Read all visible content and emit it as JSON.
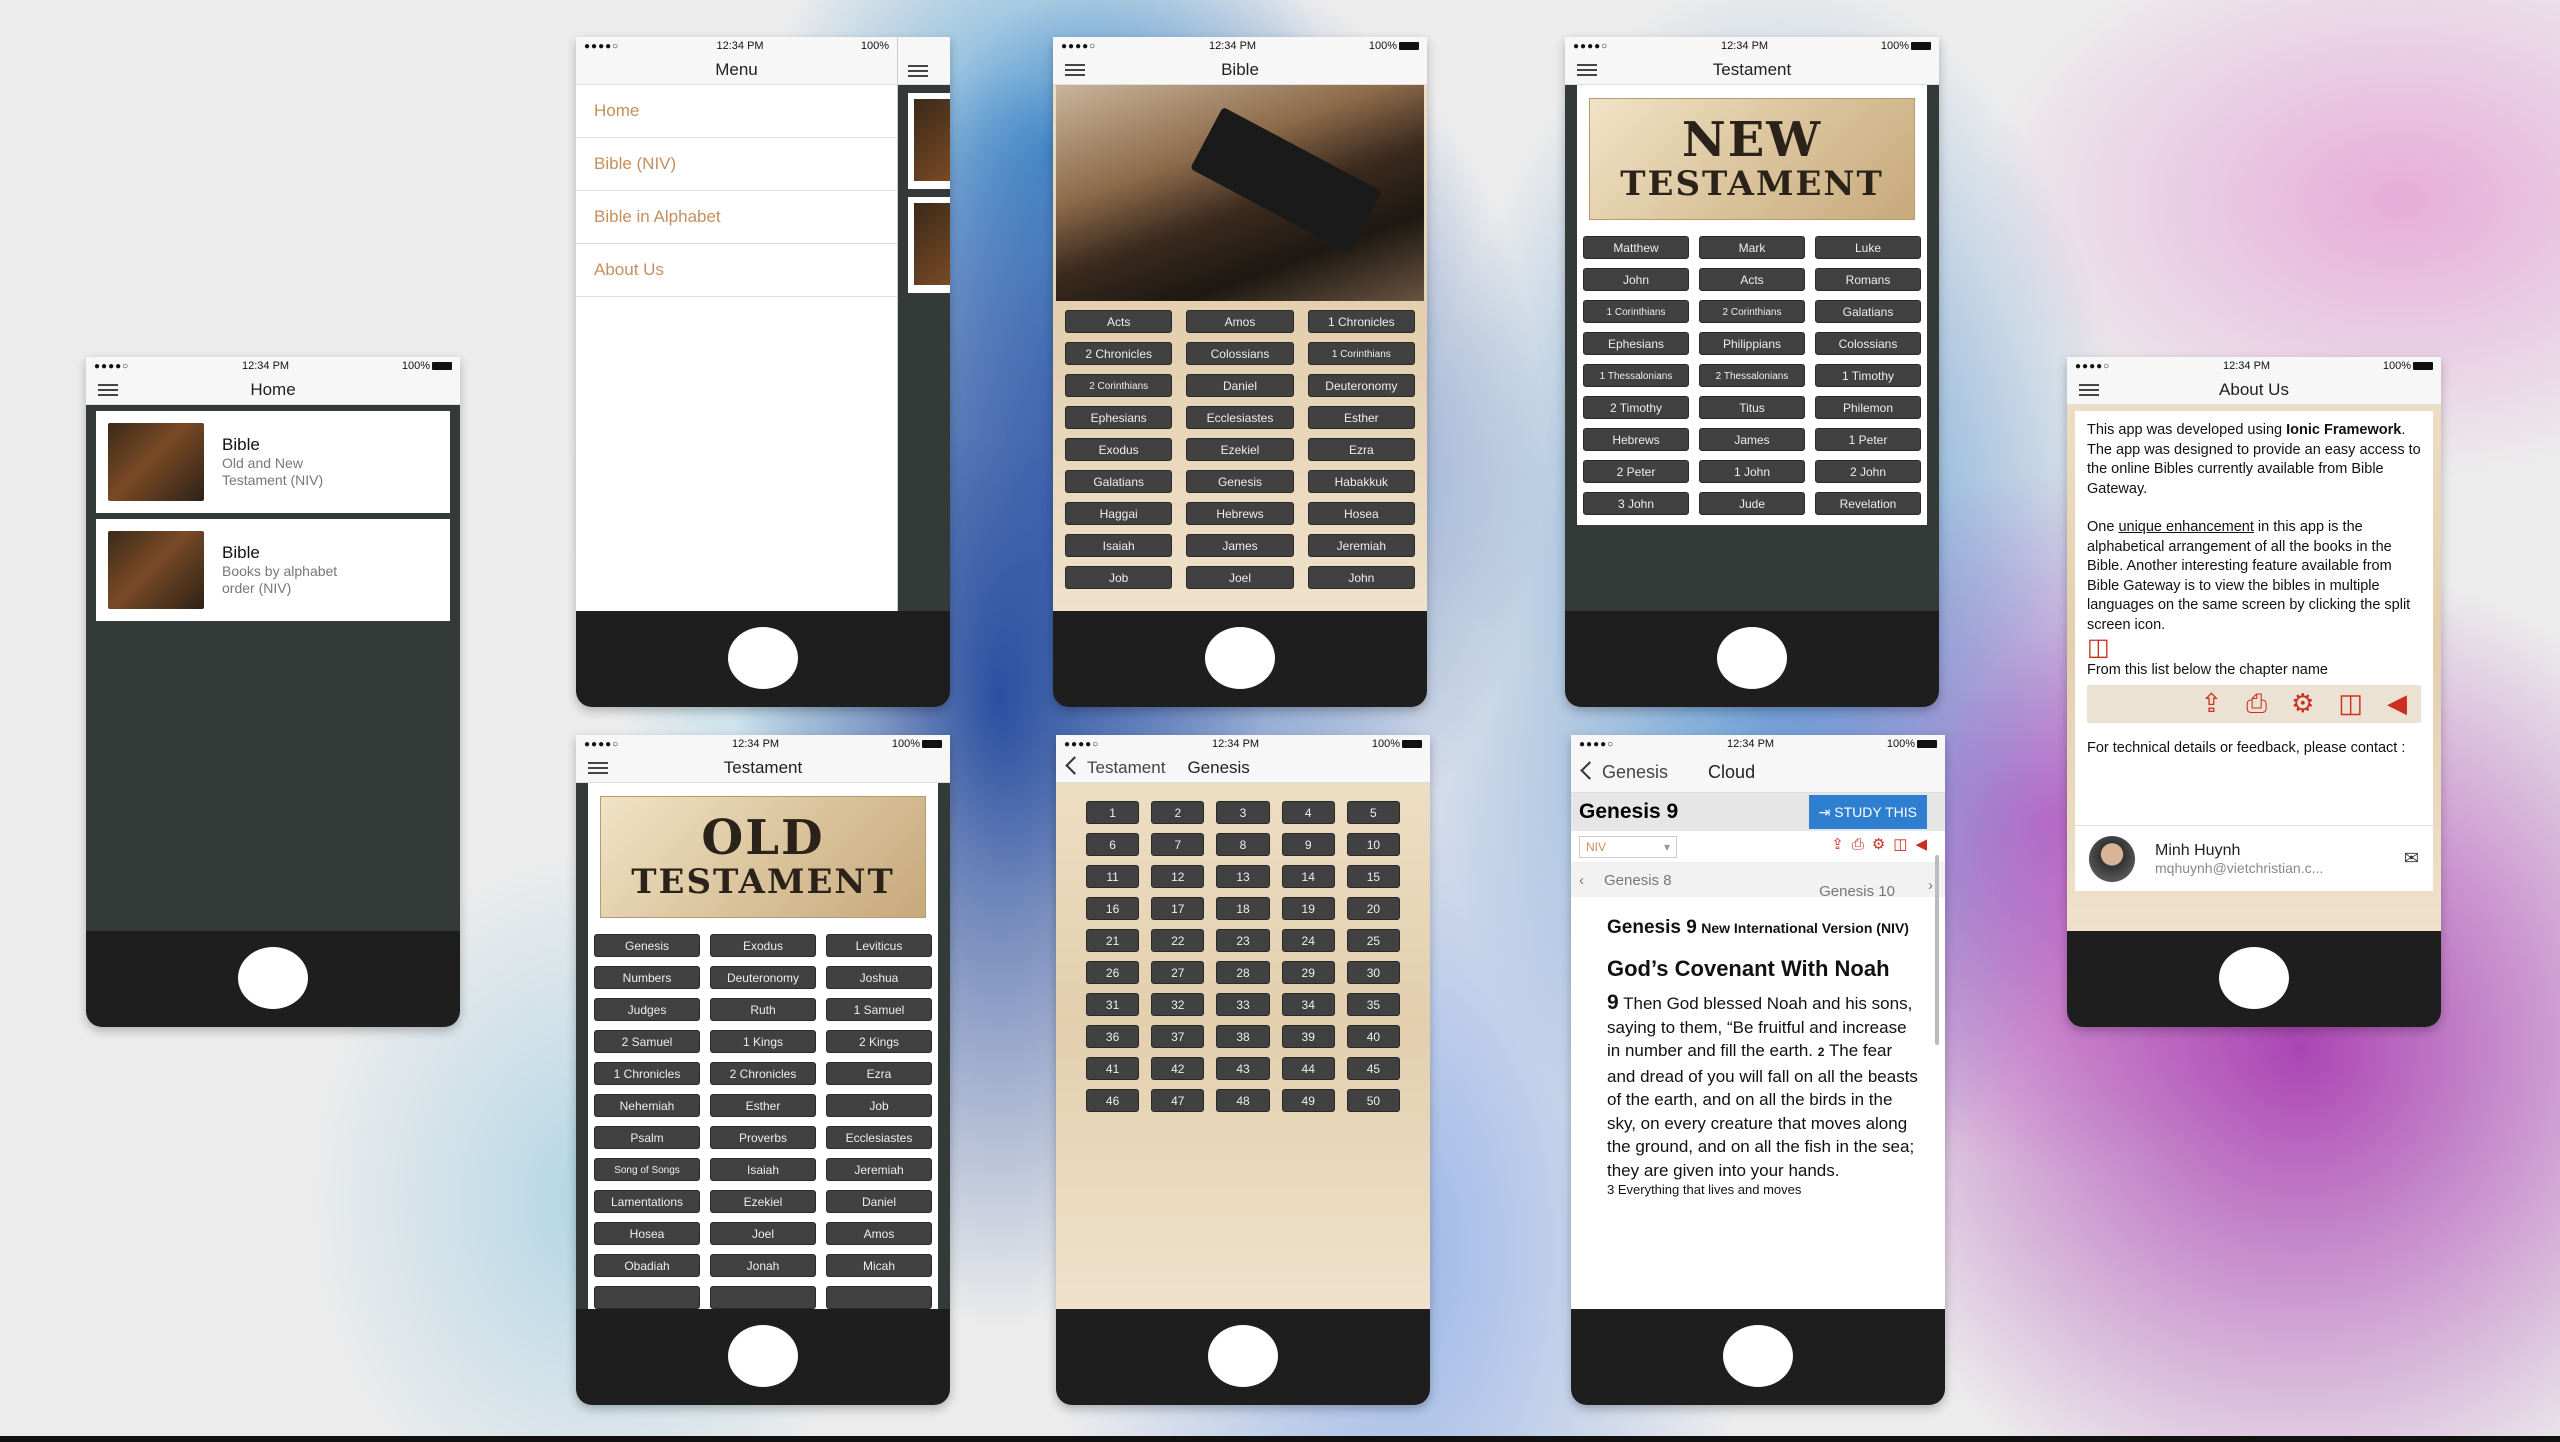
{
  "status": {
    "signal": "●●●●○",
    "time": "12:34 PM",
    "battery": "100%"
  },
  "home": {
    "title": "Home",
    "items": [
      {
        "title": "Bible",
        "subtitle": "Old and New Testament (NIV)"
      },
      {
        "title": "Bible",
        "subtitle": "Books by alphabet order (NIV)"
      }
    ]
  },
  "menu": {
    "title": "Menu",
    "items": [
      "Home",
      "Bible (NIV)",
      "Bible in Alphabet",
      "About Us"
    ]
  },
  "bible": {
    "title": "Bible",
    "books": [
      "Acts",
      "Amos",
      "1 Chronicles",
      "2 Chronicles",
      "Colossians",
      "1 Corinthians",
      "2 Corinthians",
      "Daniel",
      "Deuteronomy",
      "Ephesians",
      "Ecclesiastes",
      "Esther",
      "Exodus",
      "Ezekiel",
      "Ezra",
      "Galatians",
      "Genesis",
      "Habakkuk",
      "Haggai",
      "Hebrews",
      "Hosea",
      "Isaiah",
      "James",
      "Jeremiah",
      "Job",
      "Joel",
      "John"
    ]
  },
  "new_testament": {
    "title": "Testament",
    "banner_top": "NEW",
    "banner_bottom": "TESTAMENT",
    "books": [
      "Matthew",
      "Mark",
      "Luke",
      "John",
      "Acts",
      "Romans",
      "1 Corinthians",
      "2 Corinthians",
      "Galatians",
      "Ephesians",
      "Philippians",
      "Colossians",
      "1 Thessalonians",
      "2 Thessalonians",
      "1 Timothy",
      "2 Timothy",
      "Titus",
      "Philemon",
      "Hebrews",
      "James",
      "1 Peter",
      "2 Peter",
      "1 John",
      "2 John",
      "3 John",
      "Jude",
      "Revelation"
    ]
  },
  "old_testament": {
    "title": "Testament",
    "banner_top": "OLD",
    "banner_bottom": "TESTAMENT",
    "books": [
      "Genesis",
      "Exodus",
      "Leviticus",
      "Numbers",
      "Deuteronomy",
      "Joshua",
      "Judges",
      "Ruth",
      "1 Samuel",
      "2 Samuel",
      "1 Kings",
      "2 Kings",
      "1 Chronicles",
      "2 Chronicles",
      "Ezra",
      "Nehemiah",
      "Esther",
      "Job",
      "Psalm",
      "Proverbs",
      "Ecclesiastes",
      "Song of Songs",
      "Isaiah",
      "Jeremiah",
      "Lamentations",
      "Ezekiel",
      "Daniel",
      "Hosea",
      "Joel",
      "Amos",
      "Obadiah",
      "Jonah",
      "Micah",
      "",
      "",
      ""
    ]
  },
  "genesis": {
    "back": "Testament",
    "title": "Genesis",
    "chapters": [
      "1",
      "2",
      "3",
      "4",
      "5",
      "6",
      "7",
      "8",
      "9",
      "10",
      "11",
      "12",
      "13",
      "14",
      "15",
      "16",
      "17",
      "18",
      "19",
      "20",
      "21",
      "22",
      "23",
      "24",
      "25",
      "26",
      "27",
      "28",
      "29",
      "30",
      "31",
      "32",
      "33",
      "34",
      "35",
      "36",
      "37",
      "38",
      "39",
      "40",
      "41",
      "42",
      "43",
      "44",
      "45",
      "46",
      "47",
      "48",
      "49",
      "50"
    ]
  },
  "cloud": {
    "back": "Genesis",
    "title": "Cloud",
    "chapter": "Genesis 9",
    "study": "STUDY THIS",
    "version": "NIV",
    "prev": "Genesis 8",
    "next": "Genesis 10",
    "ref": "Genesis 9",
    "version_full": "New International Version (NIV)",
    "heading": "God’s Covenant With Noah",
    "verse_num": "9",
    "text": "Then God blessed Noah and his sons, saying to them, “Be fruitful and increase in number and fill the earth.",
    "v2": "2",
    "text2": "The fear and dread of you will fall on all the beasts of the earth, and on all the birds in the sky, on every creature that moves along the ground, and on all the fish in the sea; they are given into your hands.",
    "v3": "3 Everything that lives and moves"
  },
  "about": {
    "title": "About Us",
    "p1a": "This app was developed using ",
    "p1b": "Ionic Framework",
    "p1c": ". The app was designed to provide an easy access to the online Bibles currently available from Bible Gateway.",
    "p2a": "One ",
    "p2b": "unique enhancement",
    "p2c": " in this app is the alphabetical arrangement of all the books in the Bible. Another interesting feature available from Bible Gateway is to view the bibles in multiple languages on the same screen by clicking the split screen icon.",
    "p3": "From this list below the chapter name",
    "p4": "For technical details or feedback, please contact :",
    "name": "Minh Huynh",
    "email": "mqhuynh@vietchristian.c..."
  },
  "colors": {
    "book_button": "#414141",
    "link": "#c58f5d",
    "accent_red": "#c9301f",
    "study_blue": "#2f7fd0"
  }
}
